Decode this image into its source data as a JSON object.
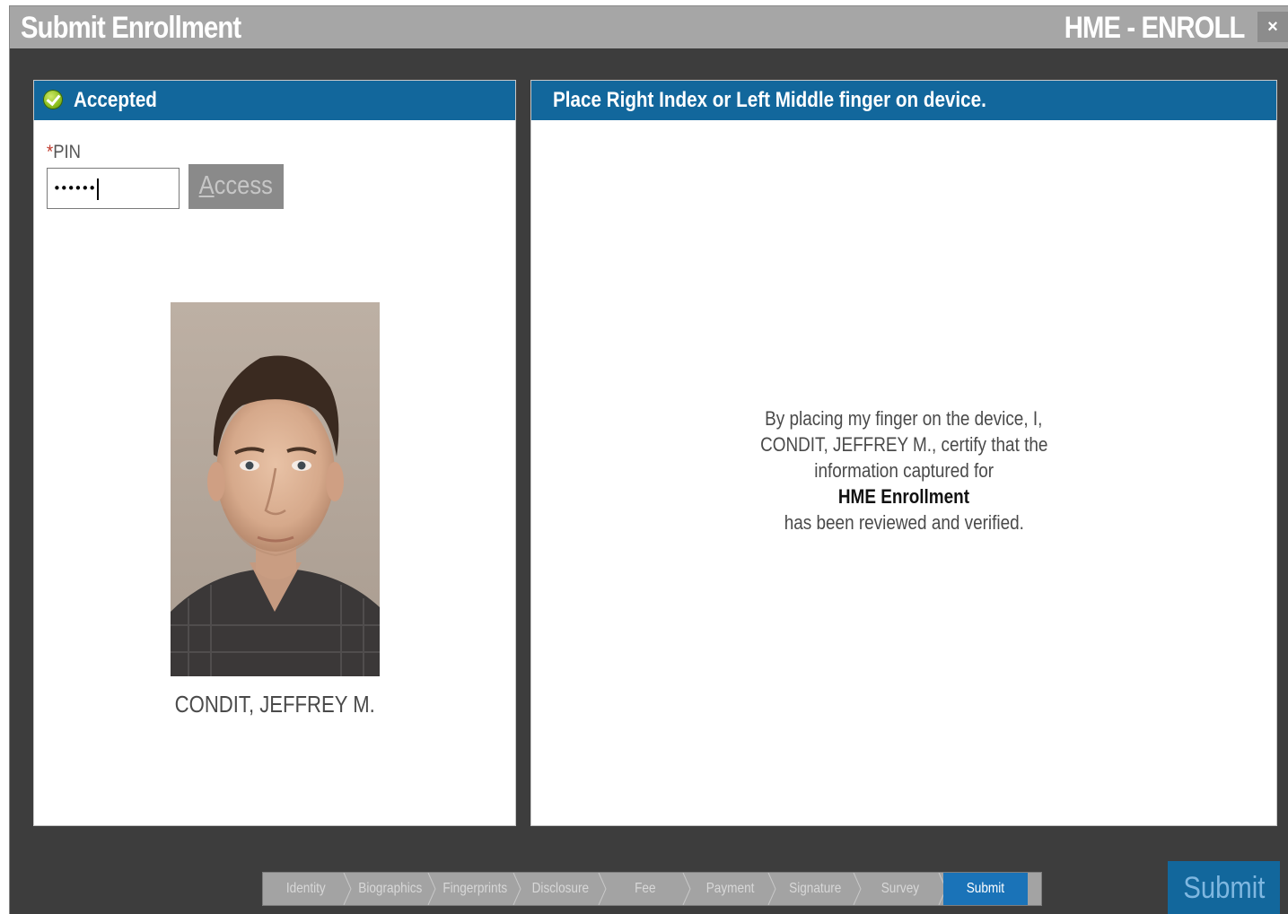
{
  "window": {
    "title": "Submit Enrollment",
    "app_name": "HME - ENROLL",
    "close_label": "×"
  },
  "left_panel": {
    "status": "Accepted",
    "pin_label_required": "*",
    "pin_label": "PIN",
    "pin_value": "••••••",
    "access_label_underlined": "A",
    "access_label_rest": "ccess",
    "person_name": "CONDIT, JEFFREY M."
  },
  "right_panel": {
    "instruction": "Place Right Index or Left Middle finger on device.",
    "certification": {
      "line1": "By placing my finger on the device, I,",
      "line2": "CONDIT, JEFFREY M., certify that the",
      "line3": "information captured for",
      "line4": "HME Enrollment",
      "line5": "has been reviewed and verified."
    }
  },
  "steps": [
    {
      "label": "Identity"
    },
    {
      "label": "Biographics"
    },
    {
      "label": "Fingerprints"
    },
    {
      "label": "Disclosure"
    },
    {
      "label": "Fee"
    },
    {
      "label": "Payment"
    },
    {
      "label": "Signature"
    },
    {
      "label": "Survey"
    },
    {
      "label": "Submit",
      "active": true
    }
  ],
  "submit_label": "Submit",
  "colors": {
    "titlebar": "#a6a6a6",
    "background": "#3d3d3d",
    "panel_header": "#12679c",
    "active_step": "#1a73b8"
  }
}
